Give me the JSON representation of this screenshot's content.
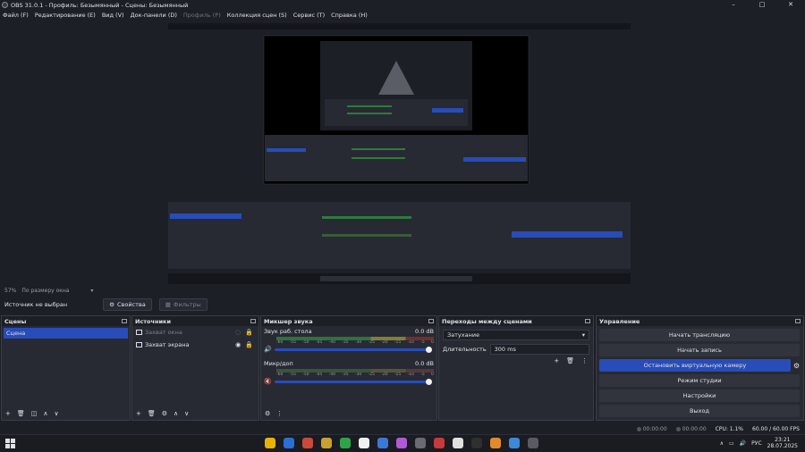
{
  "window": {
    "title": "OBS 31.0.1 - Профиль: Безымянный - Сцены: Безымянный",
    "controls": [
      "–",
      "□",
      "✕"
    ]
  },
  "menu": [
    {
      "label": "Файл (F)",
      "enabled": true
    },
    {
      "label": "Редактирование (E)",
      "enabled": true
    },
    {
      "label": "Вид (V)",
      "enabled": true
    },
    {
      "label": "Док-панели (D)",
      "enabled": true
    },
    {
      "label": "Профиль (P)",
      "enabled": false
    },
    {
      "label": "Коллекция сцен (S)",
      "enabled": true
    },
    {
      "label": "Сервис (T)",
      "enabled": true
    },
    {
      "label": "Справка (H)",
      "enabled": true
    }
  ],
  "preview": {
    "zoom": "57%",
    "scale_mode": "По размеру окна",
    "scale_arrow": "▾"
  },
  "source_bar": {
    "no_source": "Источник не выбран",
    "properties": "Свойства",
    "filters": "Фильтры"
  },
  "scenes": {
    "title": "Сцены",
    "items": [
      "Сцена"
    ],
    "selected": 0
  },
  "sources": {
    "title": "Источники",
    "items": [
      {
        "name": "Захват окна",
        "visible": false
      },
      {
        "name": "Захват экрана",
        "visible": true
      }
    ]
  },
  "mixer": {
    "title": "Микшер звука",
    "scale": [
      "-60",
      "-55",
      "-50",
      "-45",
      "-40",
      "-35",
      "-30",
      "-25",
      "-20",
      "-15",
      "-10",
      "-5",
      "0"
    ],
    "channels": [
      {
        "name": "Звук раб. стола",
        "db": "0.0 dB",
        "level": 0.0,
        "volume": 1.0,
        "muted": false
      },
      {
        "name": "Микр/доп",
        "db": "0.0 dB",
        "level": 0.0,
        "volume": 1.0,
        "muted": true
      }
    ]
  },
  "transitions": {
    "title": "Переходы между сценами",
    "type": "Затухание",
    "duration_label": "Длительность",
    "duration": "300 ms"
  },
  "controls": {
    "title": "Управление",
    "buttons": [
      {
        "label": "Начать трансляцию",
        "active": false
      },
      {
        "label": "Начать запись",
        "active": false
      },
      {
        "label": "Остановить виртуальную камеру",
        "active": true
      },
      {
        "label": "Режим студии",
        "active": false
      },
      {
        "label": "Настройки",
        "active": false
      },
      {
        "label": "Выход",
        "active": false
      }
    ]
  },
  "status": {
    "net": "00:00:00",
    "rec": "00:00:00",
    "cpu": "CPU: 1.1%",
    "fps": "60.00 / 60.00 FPS"
  },
  "taskbar": {
    "lang": "РУС",
    "time": "23:21",
    "date": "28.07.2025",
    "apps": [
      "#e8b300",
      "#2b6fd6",
      "#c94a3a",
      "#c8a030",
      "#2ea34a",
      "#f0f0f0",
      "#3a78d8",
      "#b05ad8",
      "#6a6a72",
      "#c83a3a",
      "#e0e0e0",
      "#2f2f2f",
      "#e08a2a",
      "#3a8ad8",
      "#5a5a62"
    ]
  }
}
